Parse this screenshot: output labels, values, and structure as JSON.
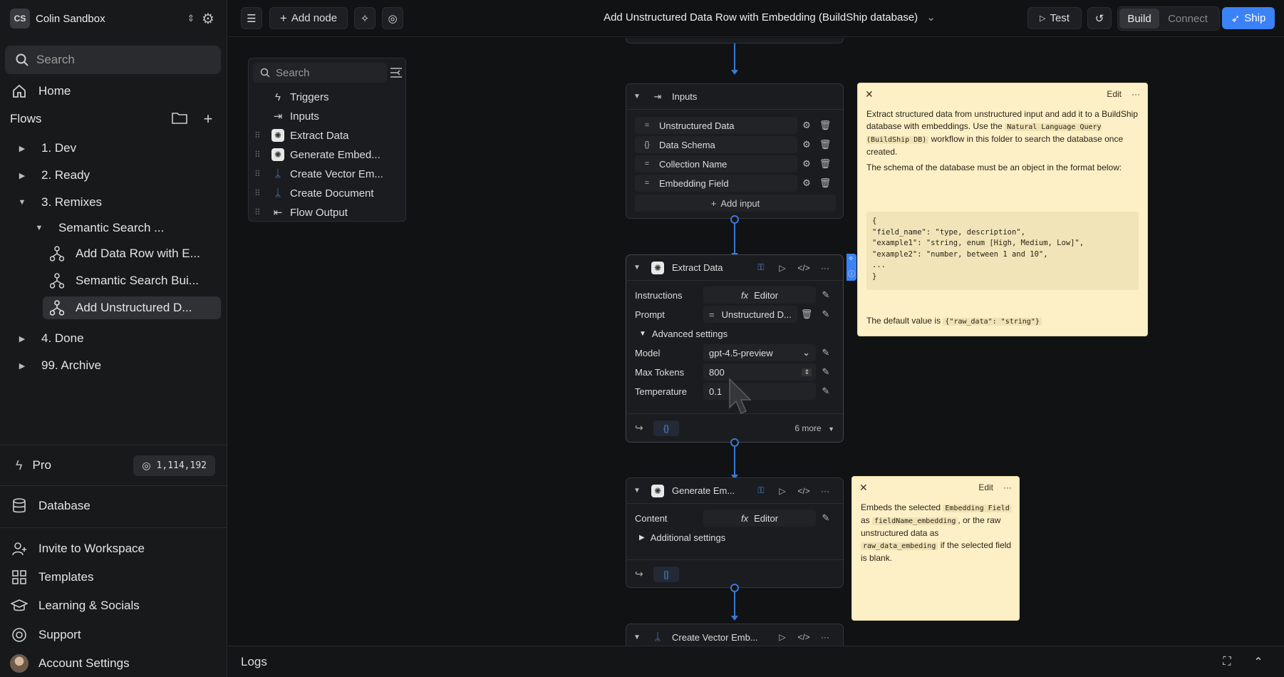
{
  "sidebar": {
    "workspace": {
      "initials": "CS",
      "name": "Colin Sandbox"
    },
    "search_placeholder": "Search",
    "home": "Home",
    "flows_label": "Flows",
    "folders": [
      {
        "label": "1. Dev"
      },
      {
        "label": "2. Ready"
      },
      {
        "label": "3. Remixes"
      }
    ],
    "subfolder": "Semantic Search ...",
    "flows": [
      {
        "label": "Add Data Row with E..."
      },
      {
        "label": "Semantic Search Bui..."
      },
      {
        "label": "Add Unstructured D..."
      }
    ],
    "folders_after": [
      {
        "label": "4. Done"
      },
      {
        "label": "99. Archive"
      }
    ],
    "plan": "Pro",
    "credits": "1,114,192",
    "database": "Database",
    "bottom": [
      {
        "label": "Invite to Workspace"
      },
      {
        "label": "Templates"
      },
      {
        "label": "Learning & Socials"
      },
      {
        "label": "Support"
      },
      {
        "label": "Account Settings"
      }
    ]
  },
  "topbar": {
    "add_node": "Add node",
    "title": "Add Unstructured Data Row with Embedding (BuildShip database)",
    "test": "Test",
    "build": "Build",
    "connect": "Connect",
    "ship": "Ship"
  },
  "panel": {
    "search_placeholder": "Search",
    "items": [
      {
        "label": "Triggers"
      },
      {
        "label": "Inputs"
      },
      {
        "label": "Extract Data"
      },
      {
        "label": "Generate Embed..."
      },
      {
        "label": "Create Vector Em..."
      },
      {
        "label": "Create Document"
      },
      {
        "label": "Flow Output"
      }
    ]
  },
  "inputs_node": {
    "title": "Inputs",
    "fields": [
      {
        "type": "=",
        "label": "Unstructured Data"
      },
      {
        "type": "{}",
        "label": "Data Schema"
      },
      {
        "type": "=",
        "label": "Collection Name"
      },
      {
        "type": "=",
        "label": "Embedding Field"
      }
    ],
    "add_input": "Add input"
  },
  "extract_node": {
    "title": "Extract Data",
    "instructions_label": "Instructions",
    "instructions_value": "Editor",
    "prompt_label": "Prompt",
    "prompt_value": "Unstructured D...",
    "advanced": "Advanced settings",
    "model_label": "Model",
    "model_value": "gpt-4.5-preview",
    "tokens_label": "Max Tokens",
    "tokens_value": "800",
    "temp_label": "Temperature",
    "temp_value": "0.1",
    "output_chip": "{}",
    "more": "6 more"
  },
  "embed_node": {
    "title": "Generate Em...",
    "content_label": "Content",
    "content_value": "Editor",
    "additional": "Additional settings",
    "output_chip": "[]"
  },
  "vector_node": {
    "title": "Create Vector Emb..."
  },
  "note1": {
    "edit": "Edit",
    "p1a": "Extract structured data from unstructured input and add it to a BuildShip database with embeddings. Use the ",
    "p1code": "Natural Language Query (BuildShip DB)",
    "p1b": " workflow in this folder to search the database once created.",
    "p2": "The schema of the database must be an object in the format below:",
    "code": "{\n\"field_name\": \"type, description\",\n\"example1\": \"string, enum [High, Medium, Low]\",\n\"example2\": \"number, between 1 and 10\",\n...\n}",
    "p3a": "The default value is ",
    "p3code": "{\"raw_data\": \"string\"}"
  },
  "note2": {
    "edit": "Edit",
    "t1": "Embeds the selected ",
    "c1": "Embedding Field",
    "t2": " as ",
    "c2": "fieldName_embedding",
    "t3": ", or the raw unstructured data as ",
    "c3": "raw_data_embeding",
    "t4": " if the selected field is blank."
  },
  "logs": {
    "label": "Logs"
  },
  "colors": {
    "accent": "#3a82f6",
    "edge": "#3a79d6",
    "note": "#fdf0c6"
  }
}
